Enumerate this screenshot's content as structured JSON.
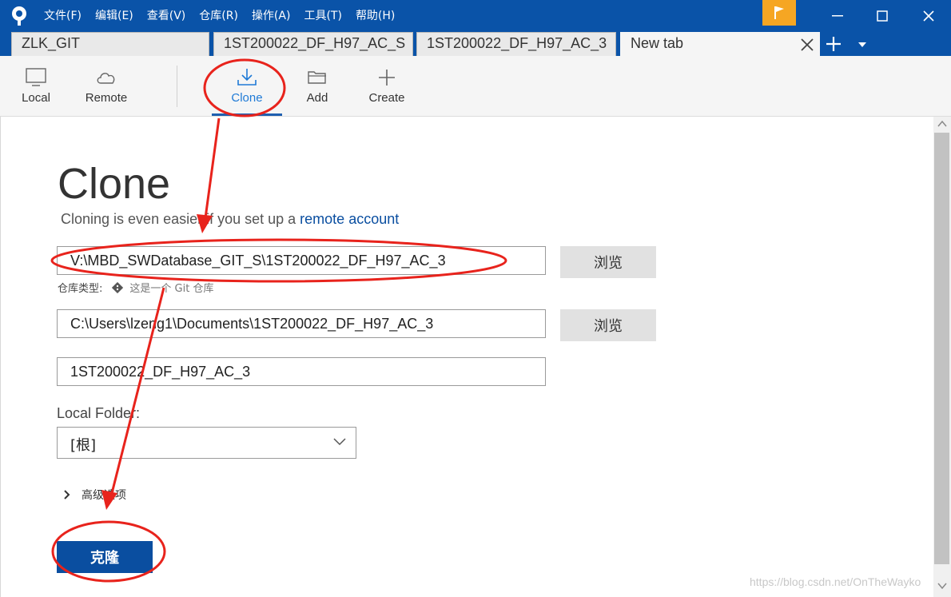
{
  "menu": [
    "文件(F)",
    "编辑(E)",
    "查看(V)",
    "仓库(R)",
    "操作(A)",
    "工具(T)",
    "帮助(H)"
  ],
  "tabs": [
    {
      "label": "ZLK_GIT"
    },
    {
      "label": "1ST200022_DF_H97_AC_S"
    },
    {
      "label": "1ST200022_DF_H97_AC_3"
    },
    {
      "label": "New tab"
    }
  ],
  "toolbar": {
    "local": "Local",
    "remote": "Remote",
    "clone": "Clone",
    "add": "Add",
    "create": "Create"
  },
  "clone_page": {
    "title": "Clone",
    "subtitle_text": "Cloning is even easier if you set up a ",
    "subtitle_link": "remote account",
    "source_url": "V:\\MBD_SWDatabase_GIT_S\\1ST200022_DF_H97_AC_3",
    "browse_label": "浏览",
    "repo_type_label": "仓库类型:",
    "repo_type_value": "这是一个 Git 仓库",
    "destination_path": "C:\\Users\\lzeng1\\Documents\\1ST200022_DF_H97_AC_3",
    "name": "1ST200022_DF_H97_AC_3",
    "local_folder_label": "Local Folder:",
    "local_folder_value": "[根]",
    "advanced_label": "高级选项",
    "clone_button": "克隆"
  },
  "watermark": "https://blog.csdn.net/OnTheWayko",
  "colors": {
    "titlebar": "#0a53a8",
    "accent": "#0a4ea0",
    "flag": "#f6a623",
    "annotation": "#e8231c"
  }
}
